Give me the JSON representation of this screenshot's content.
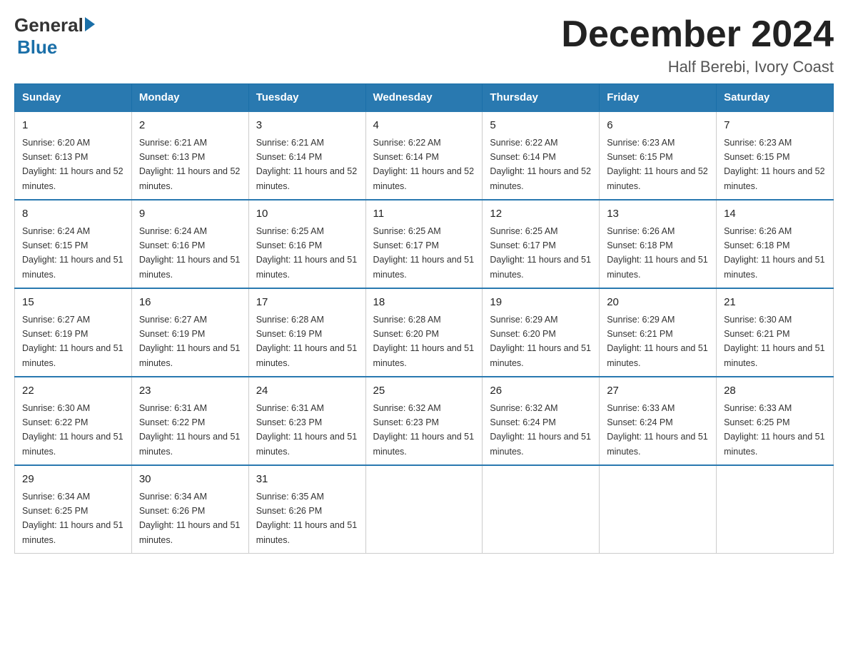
{
  "logo": {
    "general": "General",
    "blue": "Blue",
    "arrow_color": "#1a6fa8"
  },
  "title": {
    "month": "December 2024",
    "location": "Half Berebi, Ivory Coast"
  },
  "headers": [
    "Sunday",
    "Monday",
    "Tuesday",
    "Wednesday",
    "Thursday",
    "Friday",
    "Saturday"
  ],
  "weeks": [
    [
      {
        "day": "1",
        "sunrise": "6:20 AM",
        "sunset": "6:13 PM",
        "daylight": "11 hours and 52 minutes."
      },
      {
        "day": "2",
        "sunrise": "6:21 AM",
        "sunset": "6:13 PM",
        "daylight": "11 hours and 52 minutes."
      },
      {
        "day": "3",
        "sunrise": "6:21 AM",
        "sunset": "6:14 PM",
        "daylight": "11 hours and 52 minutes."
      },
      {
        "day": "4",
        "sunrise": "6:22 AM",
        "sunset": "6:14 PM",
        "daylight": "11 hours and 52 minutes."
      },
      {
        "day": "5",
        "sunrise": "6:22 AM",
        "sunset": "6:14 PM",
        "daylight": "11 hours and 52 minutes."
      },
      {
        "day": "6",
        "sunrise": "6:23 AM",
        "sunset": "6:15 PM",
        "daylight": "11 hours and 52 minutes."
      },
      {
        "day": "7",
        "sunrise": "6:23 AM",
        "sunset": "6:15 PM",
        "daylight": "11 hours and 52 minutes."
      }
    ],
    [
      {
        "day": "8",
        "sunrise": "6:24 AM",
        "sunset": "6:15 PM",
        "daylight": "11 hours and 51 minutes."
      },
      {
        "day": "9",
        "sunrise": "6:24 AM",
        "sunset": "6:16 PM",
        "daylight": "11 hours and 51 minutes."
      },
      {
        "day": "10",
        "sunrise": "6:25 AM",
        "sunset": "6:16 PM",
        "daylight": "11 hours and 51 minutes."
      },
      {
        "day": "11",
        "sunrise": "6:25 AM",
        "sunset": "6:17 PM",
        "daylight": "11 hours and 51 minutes."
      },
      {
        "day": "12",
        "sunrise": "6:25 AM",
        "sunset": "6:17 PM",
        "daylight": "11 hours and 51 minutes."
      },
      {
        "day": "13",
        "sunrise": "6:26 AM",
        "sunset": "6:18 PM",
        "daylight": "11 hours and 51 minutes."
      },
      {
        "day": "14",
        "sunrise": "6:26 AM",
        "sunset": "6:18 PM",
        "daylight": "11 hours and 51 minutes."
      }
    ],
    [
      {
        "day": "15",
        "sunrise": "6:27 AM",
        "sunset": "6:19 PM",
        "daylight": "11 hours and 51 minutes."
      },
      {
        "day": "16",
        "sunrise": "6:27 AM",
        "sunset": "6:19 PM",
        "daylight": "11 hours and 51 minutes."
      },
      {
        "day": "17",
        "sunrise": "6:28 AM",
        "sunset": "6:19 PM",
        "daylight": "11 hours and 51 minutes."
      },
      {
        "day": "18",
        "sunrise": "6:28 AM",
        "sunset": "6:20 PM",
        "daylight": "11 hours and 51 minutes."
      },
      {
        "day": "19",
        "sunrise": "6:29 AM",
        "sunset": "6:20 PM",
        "daylight": "11 hours and 51 minutes."
      },
      {
        "day": "20",
        "sunrise": "6:29 AM",
        "sunset": "6:21 PM",
        "daylight": "11 hours and 51 minutes."
      },
      {
        "day": "21",
        "sunrise": "6:30 AM",
        "sunset": "6:21 PM",
        "daylight": "11 hours and 51 minutes."
      }
    ],
    [
      {
        "day": "22",
        "sunrise": "6:30 AM",
        "sunset": "6:22 PM",
        "daylight": "11 hours and 51 minutes."
      },
      {
        "day": "23",
        "sunrise": "6:31 AM",
        "sunset": "6:22 PM",
        "daylight": "11 hours and 51 minutes."
      },
      {
        "day": "24",
        "sunrise": "6:31 AM",
        "sunset": "6:23 PM",
        "daylight": "11 hours and 51 minutes."
      },
      {
        "day": "25",
        "sunrise": "6:32 AM",
        "sunset": "6:23 PM",
        "daylight": "11 hours and 51 minutes."
      },
      {
        "day": "26",
        "sunrise": "6:32 AM",
        "sunset": "6:24 PM",
        "daylight": "11 hours and 51 minutes."
      },
      {
        "day": "27",
        "sunrise": "6:33 AM",
        "sunset": "6:24 PM",
        "daylight": "11 hours and 51 minutes."
      },
      {
        "day": "28",
        "sunrise": "6:33 AM",
        "sunset": "6:25 PM",
        "daylight": "11 hours and 51 minutes."
      }
    ],
    [
      {
        "day": "29",
        "sunrise": "6:34 AM",
        "sunset": "6:25 PM",
        "daylight": "11 hours and 51 minutes."
      },
      {
        "day": "30",
        "sunrise": "6:34 AM",
        "sunset": "6:26 PM",
        "daylight": "11 hours and 51 minutes."
      },
      {
        "day": "31",
        "sunrise": "6:35 AM",
        "sunset": "6:26 PM",
        "daylight": "11 hours and 51 minutes."
      },
      null,
      null,
      null,
      null
    ]
  ]
}
